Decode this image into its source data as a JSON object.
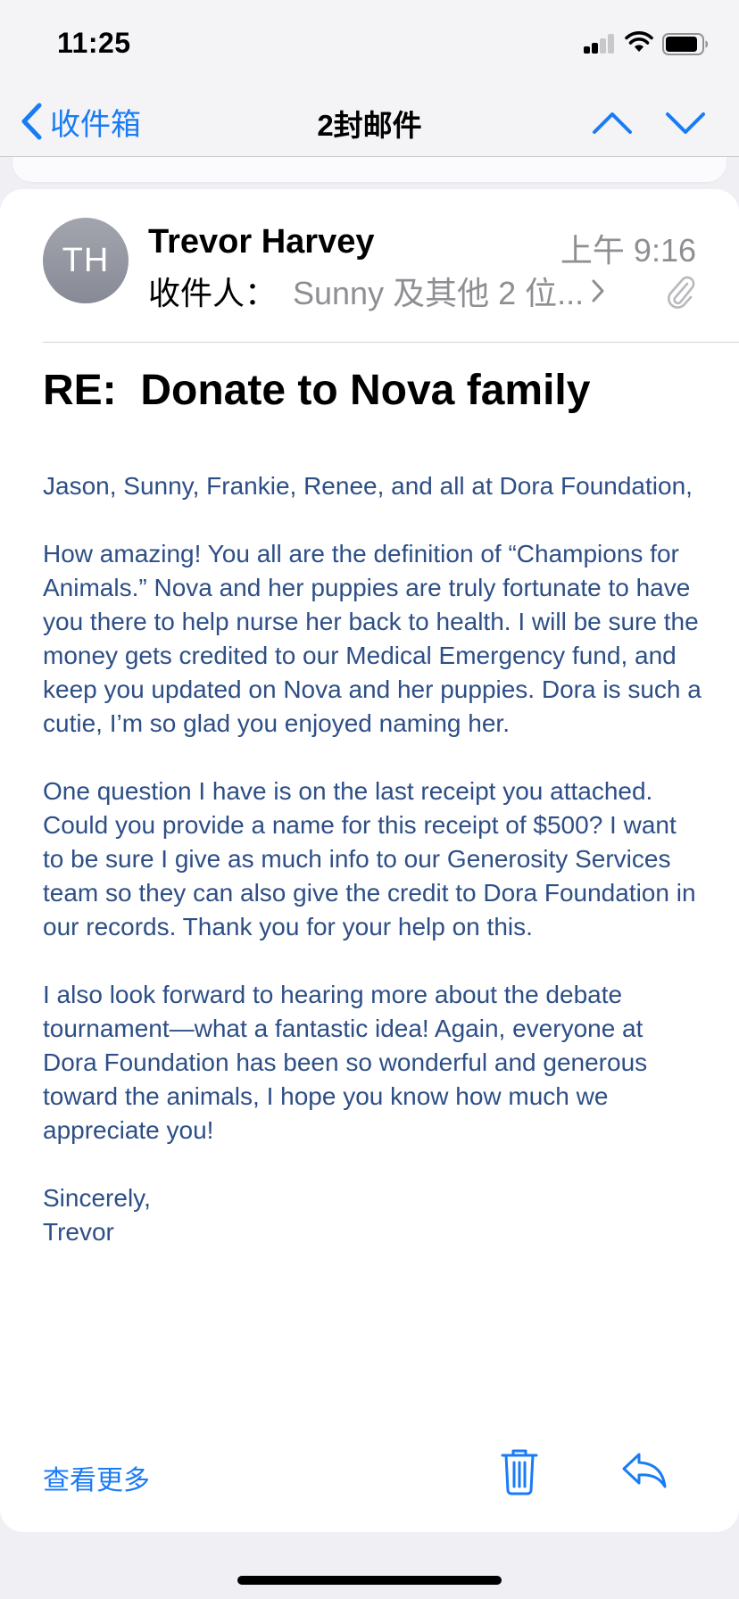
{
  "status_bar": {
    "time": "11:25"
  },
  "nav": {
    "back_label": "收件箱",
    "title": "2封邮件",
    "accent_color": "#1a7cf4",
    "icons": [
      "chevron-left-icon",
      "chevron-up-icon",
      "chevron-down-icon"
    ]
  },
  "message": {
    "avatar_initials": "TH",
    "sender": "Trevor Harvey",
    "time": "上午 9:16",
    "to_label": "收件人：",
    "to_value": "Sunny 及其他 2 位...",
    "subject": "RE:  Donate to Nova family",
    "body_color": "#2d4f86",
    "paragraphs": [
      "Jason, Sunny, Frankie, Renee, and all at Dora Foundation,",
      "How amazing! You all are the definition of “Champions for Animals.” Nova and her puppies are truly fortunate to have you there to help nurse her back to health. I will be sure the money gets credited to our Medical Emergency fund, and keep you updated on Nova and her puppies. Dora is such a cutie, I’m so glad you enjoyed naming her.",
      "One question I have is on the last receipt you attached. Could you provide a name for this receipt of $500? I want to be sure I give as much info to our Generosity Services team so they can also give the credit to Dora Foundation in our records. Thank you for your help on this.",
      "I also look forward to hearing more about the debate tournament—what a fantastic idea! Again, everyone at Dora Foundation has been so wonderful and generous toward the animals, I hope you know how much we appreciate you!"
    ],
    "signoff": "Sincerely,",
    "signature": "Trevor"
  },
  "toolbar": {
    "see_more_label": "查看更多",
    "icons": [
      "trash-icon",
      "reply-icon"
    ]
  }
}
